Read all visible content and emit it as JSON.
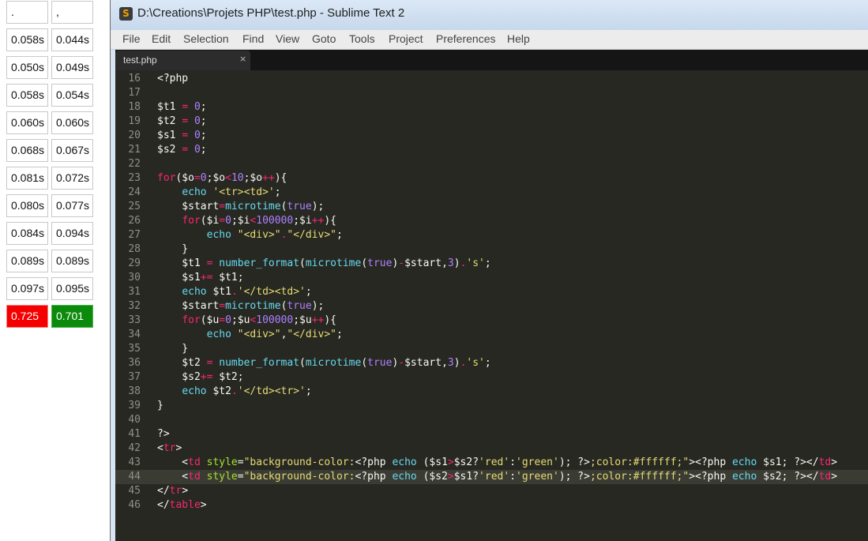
{
  "result_table": {
    "header": [
      ".",
      ","
    ],
    "rows": [
      [
        "0.058s",
        "0.044s"
      ],
      [
        "0.050s",
        "0.049s"
      ],
      [
        "0.058s",
        "0.054s"
      ],
      [
        "0.060s",
        "0.060s"
      ],
      [
        "0.068s",
        "0.067s"
      ],
      [
        "0.081s",
        "0.072s"
      ],
      [
        "0.080s",
        "0.077s"
      ],
      [
        "0.084s",
        "0.094s"
      ],
      [
        "0.089s",
        "0.089s"
      ],
      [
        "0.097s",
        "0.095s"
      ]
    ],
    "totals": [
      "0.725",
      "0.701"
    ],
    "total_colors": [
      "#f40000",
      "#0b8a0b"
    ]
  },
  "window": {
    "title": "D:\\Creations\\Projets PHP\\test.php - Sublime Text 2",
    "app_icon": "sublime-text-icon",
    "menu": [
      "File",
      "Edit",
      "Selection",
      "Find",
      "View",
      "Goto",
      "Tools",
      "Project",
      "Preferences",
      "Help"
    ],
    "tab": {
      "label": "test.php",
      "close": "×"
    }
  },
  "editor": {
    "highlighted_line": 44,
    "theme_colors": {
      "background": "#272822",
      "keyword": "#f92672",
      "number": "#ae81ff",
      "function": "#66d9ef",
      "string": "#e6db74",
      "attribute": "#a6e22e"
    },
    "lines": [
      {
        "num": "16",
        "tokens": [
          [
            "plain",
            "<?php"
          ]
        ]
      },
      {
        "num": "17",
        "tokens": []
      },
      {
        "num": "18",
        "tokens": [
          [
            "plain",
            "$t1 "
          ],
          [
            "op",
            "="
          ],
          [
            "plain",
            " "
          ],
          [
            "num",
            "0"
          ],
          [
            "plain",
            ";"
          ]
        ]
      },
      {
        "num": "19",
        "tokens": [
          [
            "plain",
            "$t2 "
          ],
          [
            "op",
            "="
          ],
          [
            "plain",
            " "
          ],
          [
            "num",
            "0"
          ],
          [
            "plain",
            ";"
          ]
        ]
      },
      {
        "num": "20",
        "tokens": [
          [
            "plain",
            "$s1 "
          ],
          [
            "op",
            "="
          ],
          [
            "plain",
            " "
          ],
          [
            "num",
            "0"
          ],
          [
            "plain",
            ";"
          ]
        ]
      },
      {
        "num": "21",
        "tokens": [
          [
            "plain",
            "$s2 "
          ],
          [
            "op",
            "="
          ],
          [
            "plain",
            " "
          ],
          [
            "num",
            "0"
          ],
          [
            "plain",
            ";"
          ]
        ]
      },
      {
        "num": "22",
        "tokens": []
      },
      {
        "num": "23",
        "tokens": [
          [
            "kw",
            "for"
          ],
          [
            "plain",
            "($o"
          ],
          [
            "op",
            "="
          ],
          [
            "num",
            "0"
          ],
          [
            "plain",
            ";$o"
          ],
          [
            "op",
            "<"
          ],
          [
            "num",
            "10"
          ],
          [
            "plain",
            ";$o"
          ],
          [
            "op",
            "++"
          ],
          [
            "plain",
            "){"
          ]
        ]
      },
      {
        "num": "24",
        "tokens": [
          [
            "plain",
            "    "
          ],
          [
            "fn",
            "echo"
          ],
          [
            "plain",
            " "
          ],
          [
            "str",
            "'<tr><td>'"
          ],
          [
            "plain",
            ";"
          ]
        ]
      },
      {
        "num": "25",
        "tokens": [
          [
            "plain",
            "    $start"
          ],
          [
            "op",
            "="
          ],
          [
            "fn",
            "microtime"
          ],
          [
            "plain",
            "("
          ],
          [
            "num",
            "true"
          ],
          [
            "plain",
            ");"
          ]
        ]
      },
      {
        "num": "26",
        "tokens": [
          [
            "plain",
            "    "
          ],
          [
            "kw",
            "for"
          ],
          [
            "plain",
            "($i"
          ],
          [
            "op",
            "="
          ],
          [
            "num",
            "0"
          ],
          [
            "plain",
            ";$i"
          ],
          [
            "op",
            "<"
          ],
          [
            "num",
            "100000"
          ],
          [
            "plain",
            ";$i"
          ],
          [
            "op",
            "++"
          ],
          [
            "plain",
            "){"
          ]
        ]
      },
      {
        "num": "27",
        "tokens": [
          [
            "plain",
            "        "
          ],
          [
            "fn",
            "echo"
          ],
          [
            "plain",
            " "
          ],
          [
            "str",
            "\"<div>\""
          ],
          [
            "op",
            "."
          ],
          [
            "str",
            "\"</div>\""
          ],
          [
            "plain",
            ";"
          ]
        ]
      },
      {
        "num": "28",
        "tokens": [
          [
            "plain",
            "    }"
          ]
        ]
      },
      {
        "num": "29",
        "tokens": [
          [
            "plain",
            "    $t1 "
          ],
          [
            "op",
            "="
          ],
          [
            "plain",
            " "
          ],
          [
            "fn",
            "number_format"
          ],
          [
            "plain",
            "("
          ],
          [
            "fn",
            "microtime"
          ],
          [
            "plain",
            "("
          ],
          [
            "num",
            "true"
          ],
          [
            "plain",
            ")"
          ],
          [
            "op",
            "-"
          ],
          [
            "plain",
            "$start,"
          ],
          [
            "num",
            "3"
          ],
          [
            "plain",
            ")"
          ],
          [
            "op",
            "."
          ],
          [
            "str",
            "'s'"
          ],
          [
            "plain",
            ";"
          ]
        ]
      },
      {
        "num": "30",
        "tokens": [
          [
            "plain",
            "    $s1"
          ],
          [
            "op",
            "+="
          ],
          [
            "plain",
            " $t1;"
          ]
        ]
      },
      {
        "num": "31",
        "tokens": [
          [
            "plain",
            "    "
          ],
          [
            "fn",
            "echo"
          ],
          [
            "plain",
            " $t1"
          ],
          [
            "op",
            "."
          ],
          [
            "str",
            "'</td><td>'"
          ],
          [
            "plain",
            ";"
          ]
        ]
      },
      {
        "num": "32",
        "tokens": [
          [
            "plain",
            "    $start"
          ],
          [
            "op",
            "="
          ],
          [
            "fn",
            "microtime"
          ],
          [
            "plain",
            "("
          ],
          [
            "num",
            "true"
          ],
          [
            "plain",
            ");"
          ]
        ]
      },
      {
        "num": "33",
        "tokens": [
          [
            "plain",
            "    "
          ],
          [
            "kw",
            "for"
          ],
          [
            "plain",
            "($u"
          ],
          [
            "op",
            "="
          ],
          [
            "num",
            "0"
          ],
          [
            "plain",
            ";$u"
          ],
          [
            "op",
            "<"
          ],
          [
            "num",
            "100000"
          ],
          [
            "plain",
            ";$u"
          ],
          [
            "op",
            "++"
          ],
          [
            "plain",
            "){"
          ]
        ]
      },
      {
        "num": "34",
        "tokens": [
          [
            "plain",
            "        "
          ],
          [
            "fn",
            "echo"
          ],
          [
            "plain",
            " "
          ],
          [
            "str",
            "\"<div>\""
          ],
          [
            "plain",
            ","
          ],
          [
            "str",
            "\"</div>\""
          ],
          [
            "plain",
            ";"
          ]
        ]
      },
      {
        "num": "35",
        "tokens": [
          [
            "plain",
            "    }"
          ]
        ]
      },
      {
        "num": "36",
        "tokens": [
          [
            "plain",
            "    $t2 "
          ],
          [
            "op",
            "="
          ],
          [
            "plain",
            " "
          ],
          [
            "fn",
            "number_format"
          ],
          [
            "plain",
            "("
          ],
          [
            "fn",
            "microtime"
          ],
          [
            "plain",
            "("
          ],
          [
            "num",
            "true"
          ],
          [
            "plain",
            ")"
          ],
          [
            "op",
            "-"
          ],
          [
            "plain",
            "$start,"
          ],
          [
            "num",
            "3"
          ],
          [
            "plain",
            ")"
          ],
          [
            "op",
            "."
          ],
          [
            "str",
            "'s'"
          ],
          [
            "plain",
            ";"
          ]
        ]
      },
      {
        "num": "37",
        "tokens": [
          [
            "plain",
            "    $s2"
          ],
          [
            "op",
            "+="
          ],
          [
            "plain",
            " $t2;"
          ]
        ]
      },
      {
        "num": "38",
        "tokens": [
          [
            "plain",
            "    "
          ],
          [
            "fn",
            "echo"
          ],
          [
            "plain",
            " $t2"
          ],
          [
            "op",
            "."
          ],
          [
            "str",
            "'</td><tr>'"
          ],
          [
            "plain",
            ";"
          ]
        ]
      },
      {
        "num": "39",
        "tokens": [
          [
            "plain",
            "}"
          ]
        ]
      },
      {
        "num": "40",
        "tokens": []
      },
      {
        "num": "41",
        "tokens": [
          [
            "plain",
            "?>"
          ]
        ]
      },
      {
        "num": "42",
        "tokens": [
          [
            "plain",
            "<"
          ],
          [
            "tag",
            "tr"
          ],
          [
            "plain",
            ">"
          ]
        ]
      },
      {
        "num": "43",
        "tokens": [
          [
            "plain",
            "    <"
          ],
          [
            "tag",
            "td"
          ],
          [
            "plain",
            " "
          ],
          [
            "attr",
            "style"
          ],
          [
            "plain",
            "="
          ],
          [
            "str",
            "\"background-color:"
          ],
          [
            "plain",
            "<?php "
          ],
          [
            "fn",
            "echo"
          ],
          [
            "plain",
            " ($s1"
          ],
          [
            "op",
            ">"
          ],
          [
            "plain",
            "$s2?"
          ],
          [
            "str",
            "'red'"
          ],
          [
            "plain",
            ":"
          ],
          [
            "str",
            "'green'"
          ],
          [
            "plain",
            "); ?>"
          ],
          [
            "str",
            ";color:#ffffff;\""
          ],
          [
            "plain",
            "><?php "
          ],
          [
            "fn",
            "echo"
          ],
          [
            "plain",
            " $s1; ?></"
          ],
          [
            "tag",
            "td"
          ],
          [
            "plain",
            ">"
          ]
        ]
      },
      {
        "num": "44",
        "tokens": [
          [
            "plain",
            "    <"
          ],
          [
            "tag",
            "td"
          ],
          [
            "plain",
            " "
          ],
          [
            "attr",
            "style"
          ],
          [
            "plain",
            "="
          ],
          [
            "str",
            "\"background-color:"
          ],
          [
            "plain",
            "<?php "
          ],
          [
            "fn",
            "echo"
          ],
          [
            "plain",
            " ($s2"
          ],
          [
            "op",
            ">"
          ],
          [
            "plain",
            "$s1?"
          ],
          [
            "str",
            "'red'"
          ],
          [
            "plain",
            ":"
          ],
          [
            "str",
            "'green'"
          ],
          [
            "plain",
            "); ?>"
          ],
          [
            "str",
            ";color:#ffffff;\""
          ],
          [
            "plain",
            "><?php "
          ],
          [
            "fn",
            "echo"
          ],
          [
            "plain",
            " $s2; ?></"
          ],
          [
            "tag",
            "td"
          ],
          [
            "plain",
            ">"
          ]
        ]
      },
      {
        "num": "45",
        "tokens": [
          [
            "plain",
            "</"
          ],
          [
            "tag",
            "tr"
          ],
          [
            "plain",
            ">"
          ]
        ]
      },
      {
        "num": "46",
        "tokens": [
          [
            "plain",
            "</"
          ],
          [
            "tag",
            "table"
          ],
          [
            "plain",
            ">"
          ]
        ]
      }
    ]
  }
}
